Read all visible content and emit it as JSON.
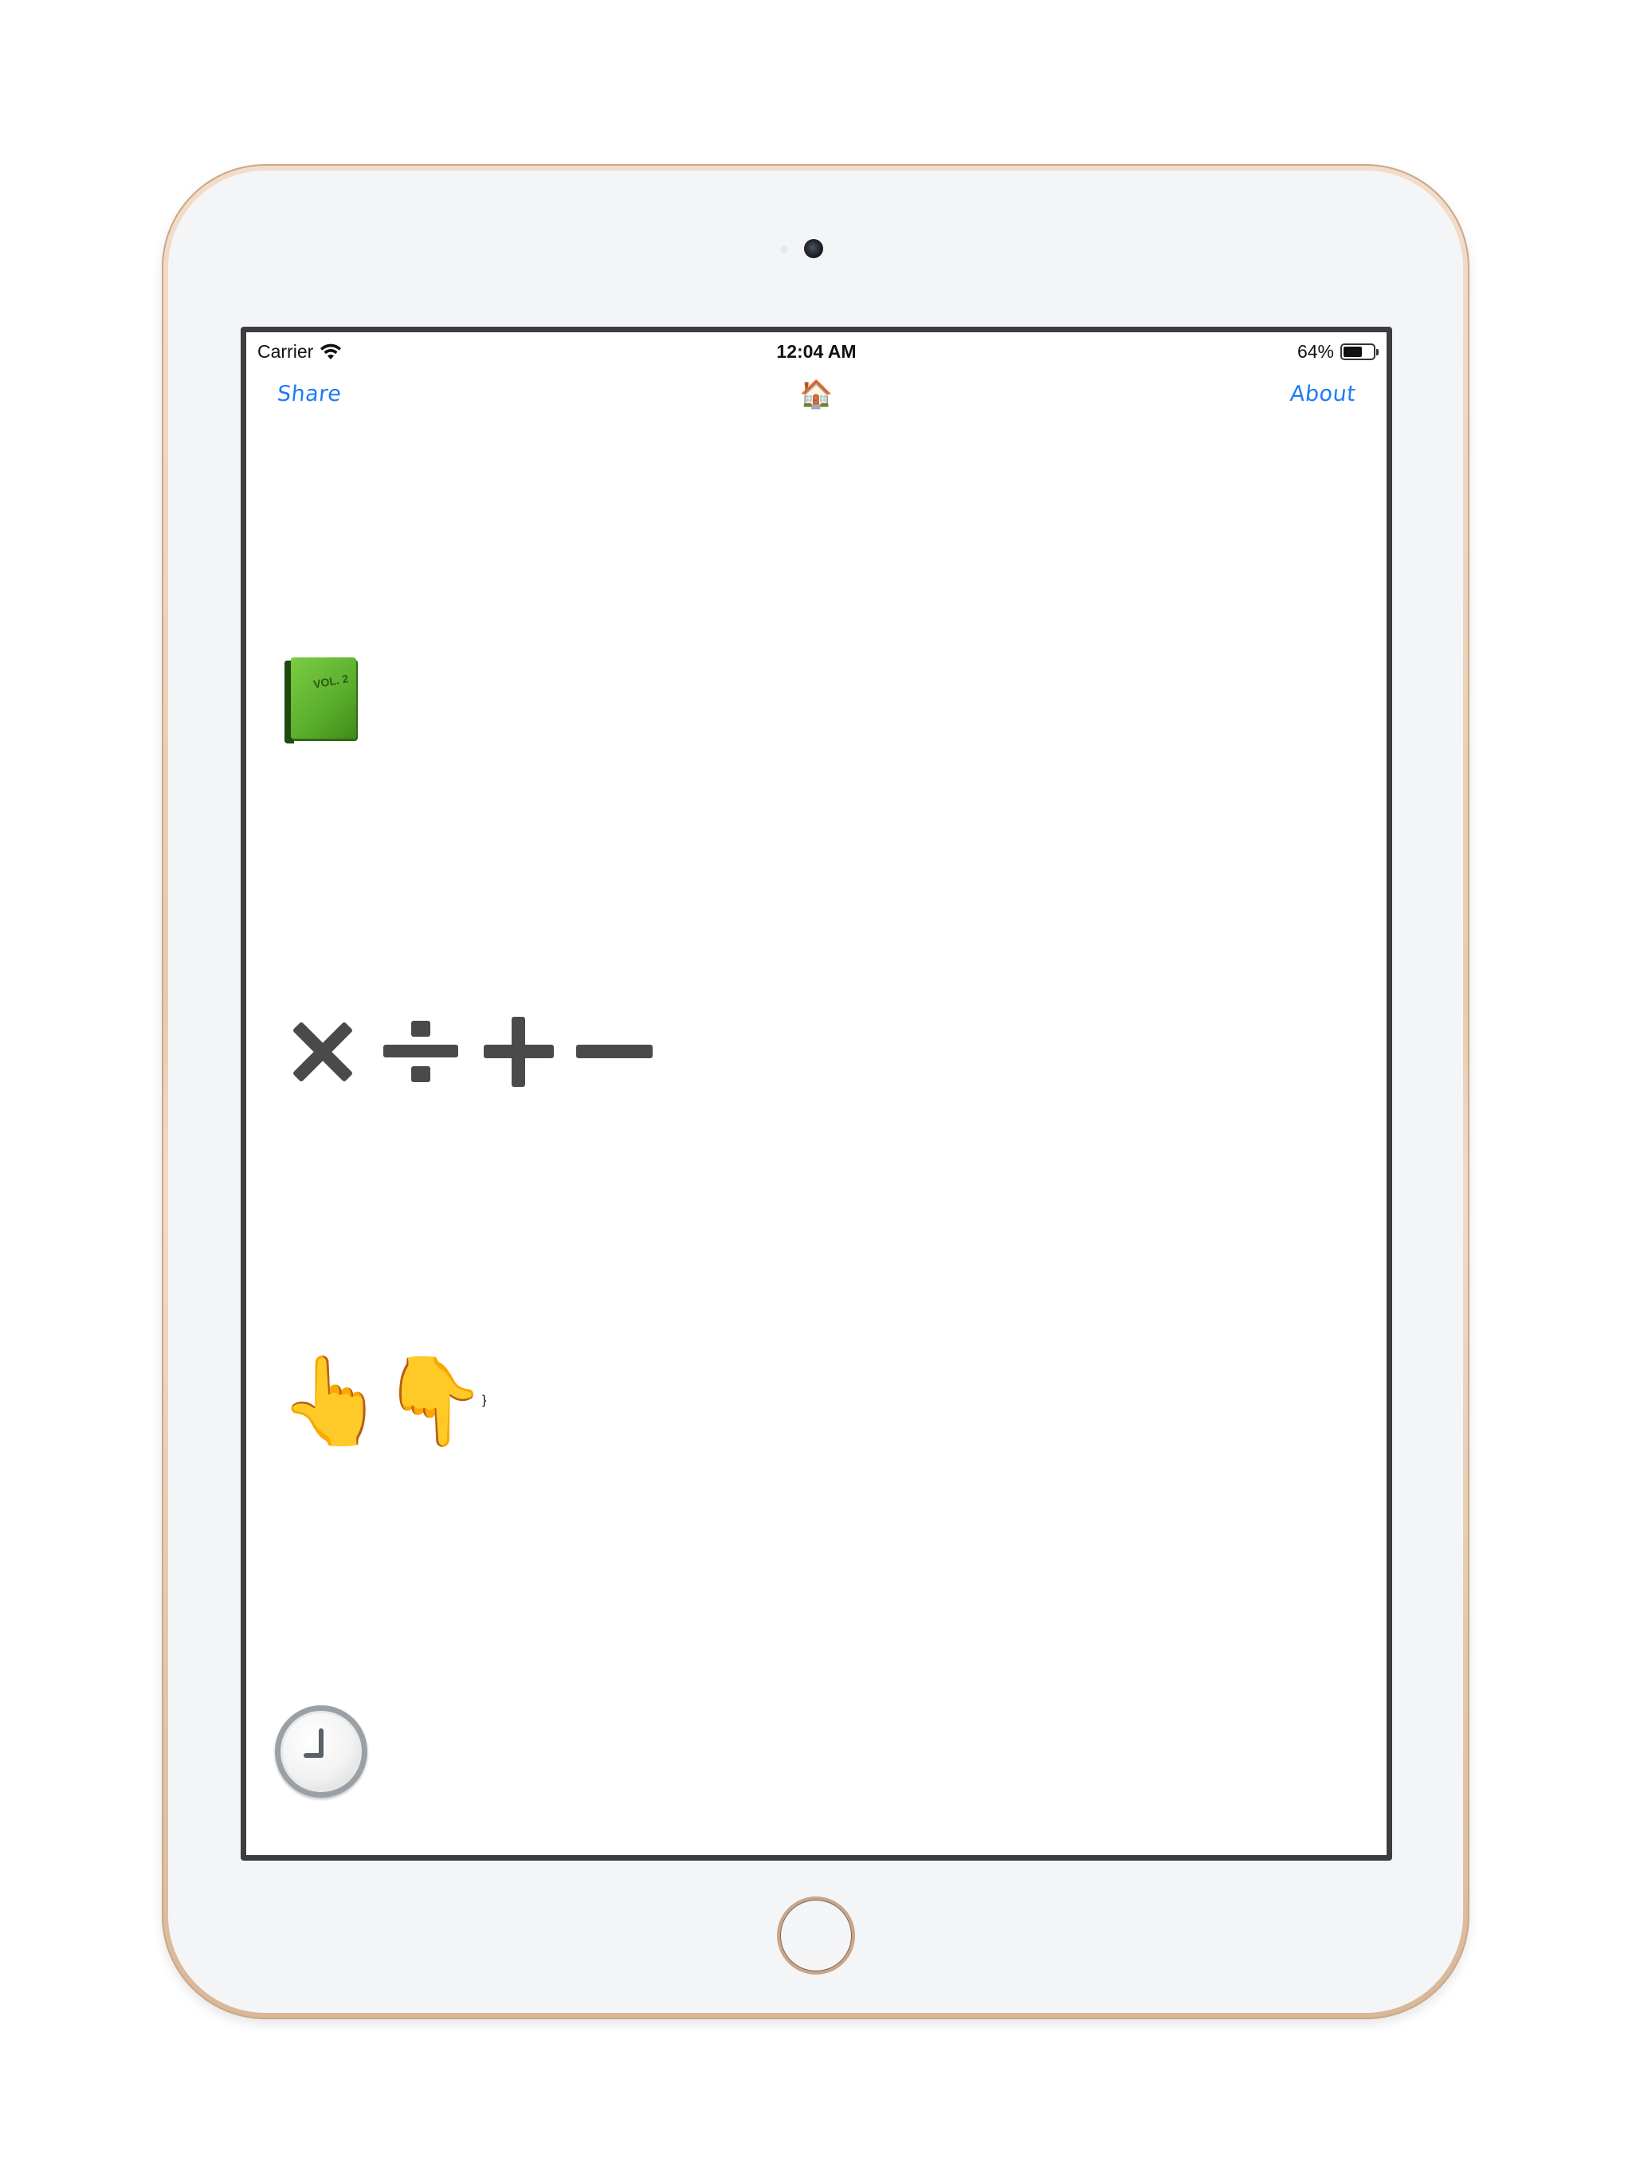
{
  "status_bar": {
    "carrier": "Carrier",
    "time": "12:04 AM",
    "battery_percent_label": "64%",
    "battery_level": 0.64
  },
  "nav": {
    "share_label": "Share",
    "title_icon": "🏠",
    "about_label": "About"
  },
  "content": {
    "book_emoji": "green-book-icon",
    "book_label": "VOL. 2",
    "math_symbols": [
      "multiply-icon",
      "divide-icon",
      "plus-icon",
      "minus-icon"
    ],
    "pointers": [
      "👆",
      "👇"
    ],
    "clock": "clock-three-icon"
  },
  "colors": {
    "accent": "#1e7cf2",
    "symbol": "#4a4a4a",
    "screen_border": "#3c3d40",
    "device_gold": "#e8cbb0"
  }
}
